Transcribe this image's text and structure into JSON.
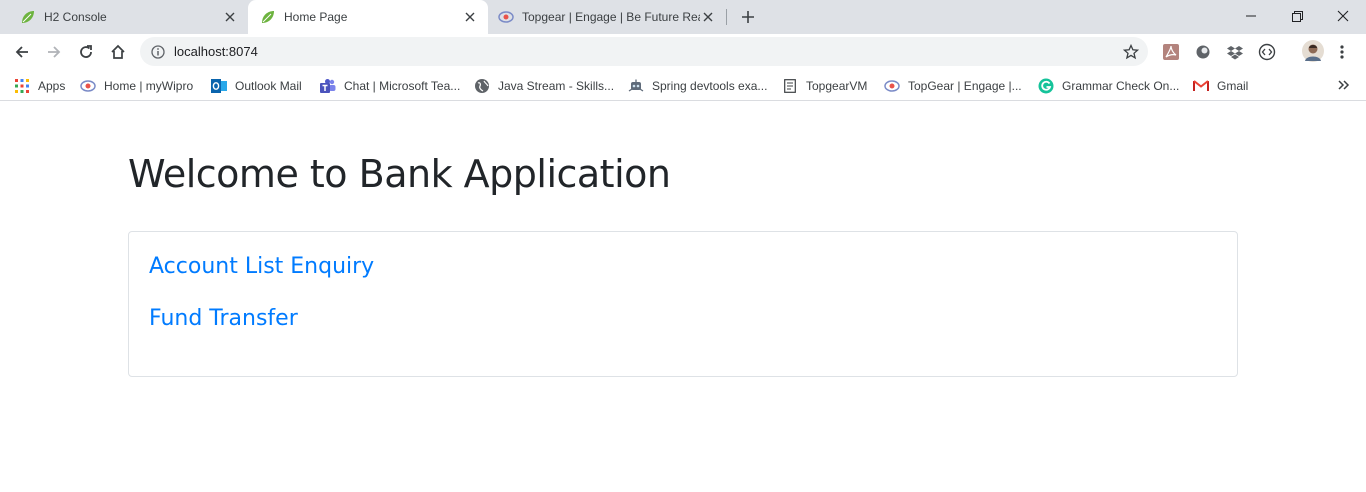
{
  "tabs": [
    {
      "title": "H2 Console",
      "icon": "spring-leaf-icon",
      "active": false
    },
    {
      "title": "Home Page",
      "icon": "spring-leaf-icon",
      "active": true
    },
    {
      "title": "Topgear | Engage | Be Future Rea",
      "icon": "topgear-icon",
      "active": false
    }
  ],
  "toolbar": {
    "url": "localhost:8074"
  },
  "bookmarks": [
    {
      "label": "Apps",
      "icon": "apps-grid-icon"
    },
    {
      "label": "Home | myWipro",
      "icon": "wipro-icon"
    },
    {
      "label": "Outlook Mail",
      "icon": "outlook-icon"
    },
    {
      "label": "Chat | Microsoft Tea...",
      "icon": "teams-icon"
    },
    {
      "label": "Java Stream - Skills...",
      "icon": "globe-icon"
    },
    {
      "label": "Spring devtools exa...",
      "icon": "robot-icon"
    },
    {
      "label": "TopgearVM",
      "icon": "document-icon"
    },
    {
      "label": "TopGear | Engage |...",
      "icon": "topgear-icon"
    },
    {
      "label": "Grammar Check On...",
      "icon": "grammarly-icon"
    },
    {
      "label": "Gmail",
      "icon": "gmail-icon"
    }
  ],
  "page": {
    "title": "Welcome to Bank Application",
    "links": [
      {
        "label": "Account List Enquiry"
      },
      {
        "label": "Fund Transfer"
      }
    ]
  },
  "colors": {
    "link": "#007bff",
    "heading": "#212529",
    "tabstrip": "#dee1e6"
  }
}
